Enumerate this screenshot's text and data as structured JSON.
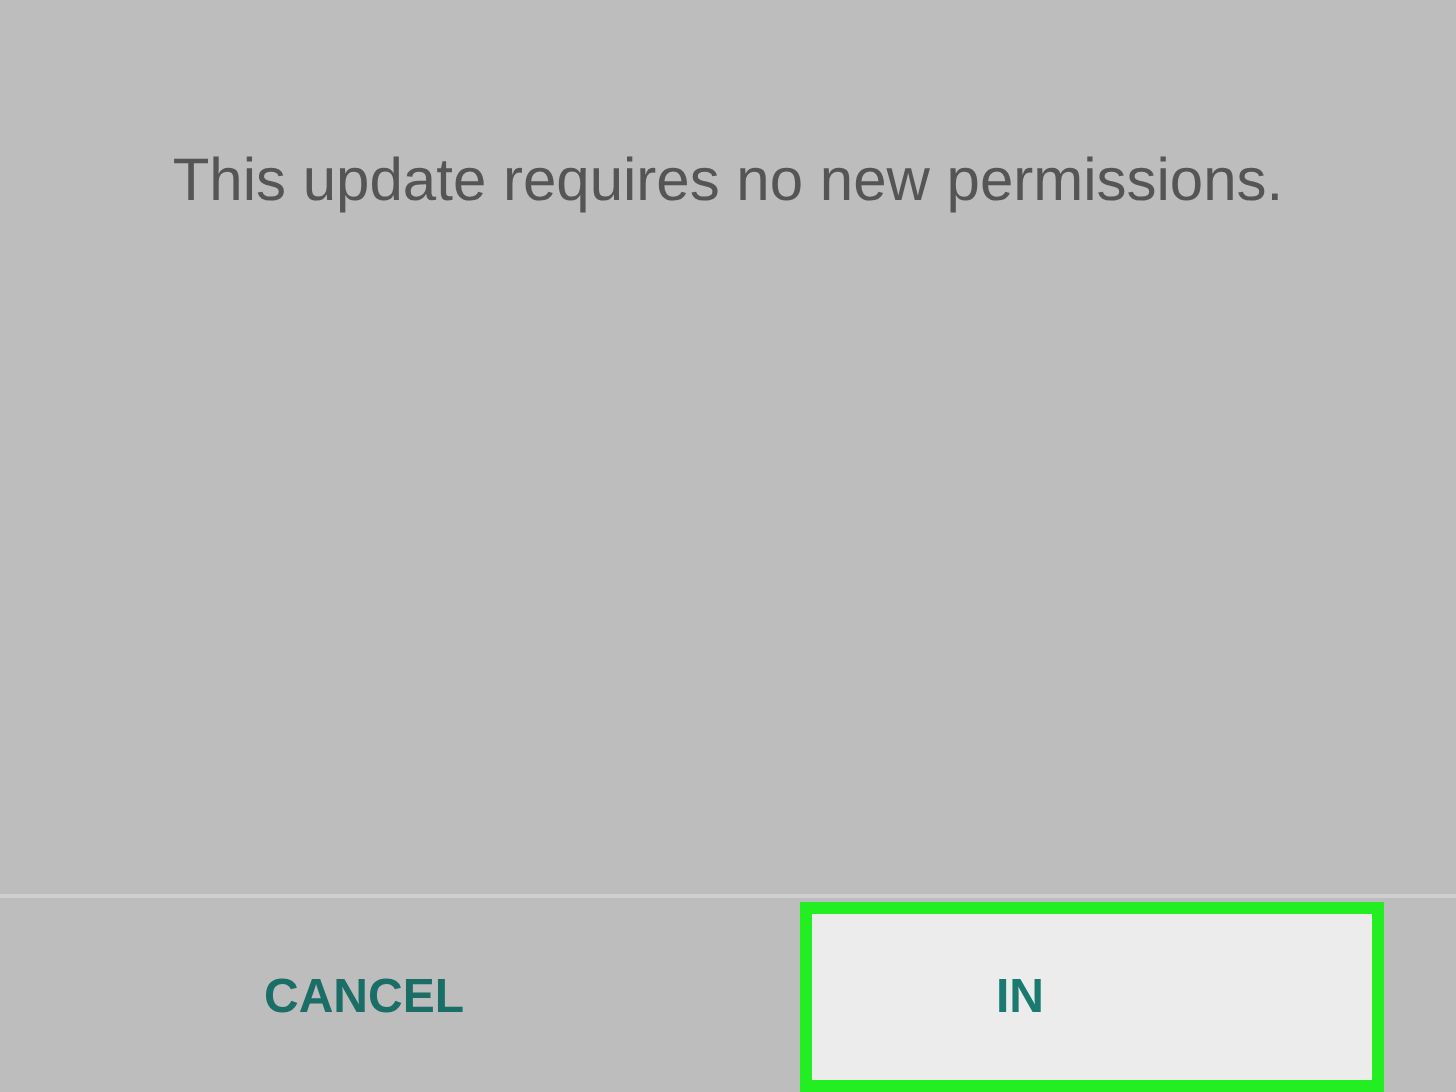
{
  "message": "This update requires no new permissions.",
  "buttons": [
    {
      "label": "CANCEL",
      "highlighted": false
    },
    {
      "label": "IN",
      "highlighted": true
    }
  ]
}
